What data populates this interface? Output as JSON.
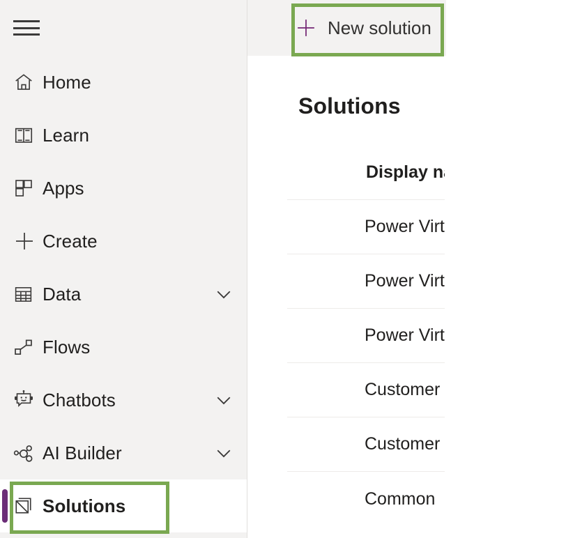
{
  "sidebar": {
    "menu_button": "menu-hamburger",
    "items": [
      {
        "label": "Home",
        "icon": "home-icon",
        "expandable": false,
        "selected": false
      },
      {
        "label": "Learn",
        "icon": "book-icon",
        "expandable": false,
        "selected": false
      },
      {
        "label": "Apps",
        "icon": "apps-grid-icon",
        "expandable": false,
        "selected": false
      },
      {
        "label": "Create",
        "icon": "plus-icon",
        "expandable": false,
        "selected": false
      },
      {
        "label": "Data",
        "icon": "table-icon",
        "expandable": true,
        "selected": false
      },
      {
        "label": "Flows",
        "icon": "flows-icon",
        "expandable": false,
        "selected": false
      },
      {
        "label": "Chatbots",
        "icon": "robot-icon",
        "expandable": true,
        "selected": false
      },
      {
        "label": "AI Builder",
        "icon": "ai-builder-icon",
        "expandable": true,
        "selected": false
      },
      {
        "label": "Solutions",
        "icon": "solutions-icon",
        "expandable": false,
        "selected": true
      }
    ]
  },
  "command_bar": {
    "new_solution_label": "New solution",
    "new_solution_icon": "plus-icon"
  },
  "main": {
    "page_title": "Solutions",
    "table": {
      "columns": [
        "Display na"
      ],
      "rows": [
        {
          "display_name": "Power Virt"
        },
        {
          "display_name": "Power Virt"
        },
        {
          "display_name": "Power Virt"
        },
        {
          "display_name": "Customer"
        },
        {
          "display_name": "Customer"
        },
        {
          "display_name": "Common"
        }
      ]
    }
  },
  "annotations": {
    "highlight_color": "#7aa851",
    "targets": [
      "New solution",
      "Solutions"
    ]
  },
  "colors": {
    "accent_purple": "#6b2d77",
    "icon_purple": "#742774",
    "sidebar_bg": "#f3f2f1",
    "highlight_green": "#7aa851"
  }
}
